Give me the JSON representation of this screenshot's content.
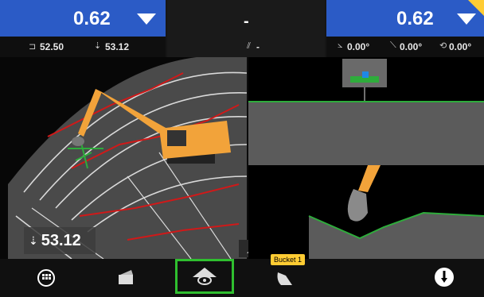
{
  "top_left": {
    "cut_fill_value": "0.62",
    "indicator_up_value": "52.50",
    "indicator_elev_value": "53.12"
  },
  "top_center": {
    "value": "-",
    "sub_value": "-"
  },
  "top_right": {
    "cut_fill_value": "0.62",
    "cross_slope": "0.00°",
    "main_slope": "0.00°",
    "bucket_angle": "0.00°"
  },
  "elevation_readout": "53.12",
  "bottom_bar": {
    "bucket_label": "Bucket 1"
  },
  "colors": {
    "blue_panel": "#2b5bc6",
    "excavator_orange": "#f2a33a",
    "grade_green": "#2eac3b",
    "highlight_border": "#2fbf2f",
    "alert_yellow": "#ffcc33"
  },
  "icons": {
    "menu": "grid-menu-icon",
    "view_select": "view-select-icon",
    "camera_view": "camera-view-icon",
    "bucket": "bucket-icon",
    "alert": "alert-icon",
    "collapse": "chevron-up-icon"
  }
}
